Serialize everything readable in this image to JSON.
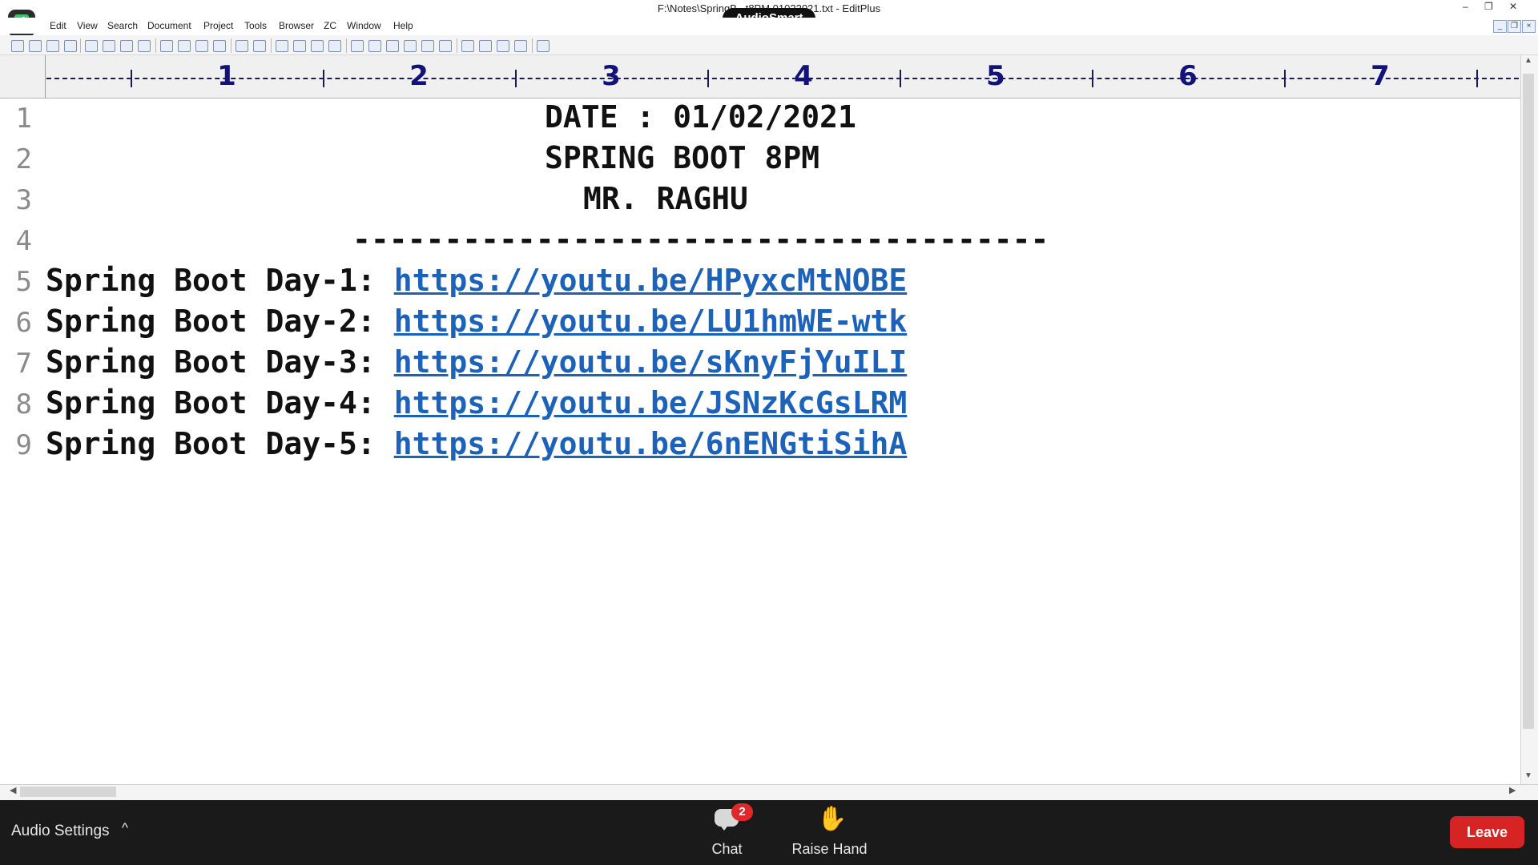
{
  "window": {
    "title": "F:\\Notes\\SpringB...t8PM 01022021.txt - EditPlus",
    "minimize": "–",
    "restore": "❐",
    "close": "✕"
  },
  "overlay": {
    "audiosmart": "AudioSmart"
  },
  "menu": [
    "Edit",
    "View",
    "Search",
    "Document",
    "Project",
    "Tools",
    "Browser",
    "ZC",
    "Window",
    "Help"
  ],
  "ruler": {
    "numbers": [
      "1",
      "2",
      "3",
      "4",
      "5",
      "6",
      "7"
    ]
  },
  "editor": {
    "lines": [
      {
        "num": "1",
        "text": "DATE : 01/02/2021",
        "link": ""
      },
      {
        "num": "2",
        "text": "SPRING BOOT 8PM",
        "link": ""
      },
      {
        "num": "3",
        "text": "MR. RAGHU",
        "link": ""
      },
      {
        "num": "4",
        "text": "--------------------------------------",
        "link": ""
      },
      {
        "num": "5",
        "text": "Spring Boot Day-1: ",
        "link": "https://youtu.be/HPyxcMtNOBE"
      },
      {
        "num": "6",
        "text": "Spring Boot Day-2: ",
        "link": "https://youtu.be/LU1hmWE-wtk"
      },
      {
        "num": "7",
        "text": "Spring Boot Day-3: ",
        "link": "https://youtu.be/sKnyFjYuILI"
      },
      {
        "num": "8",
        "text": "Spring Boot Day-4: ",
        "link": "https://youtu.be/JSNzKcGsLRM"
      },
      {
        "num": "9",
        "text": "Spring Boot Day-5: ",
        "link": "https://youtu.be/6nENGtiSihA"
      }
    ]
  },
  "meeting": {
    "audio_settings": "Audio Settings",
    "audio_chevron": "^",
    "chat_label": "Chat",
    "chat_badge": "2",
    "raise_hand_label": "Raise Hand",
    "leave_label": "Leave"
  },
  "colors": {
    "link": "#1c62b8",
    "ruler_text": "#12127a",
    "leave": "#d62323",
    "badge": "#e02828"
  }
}
